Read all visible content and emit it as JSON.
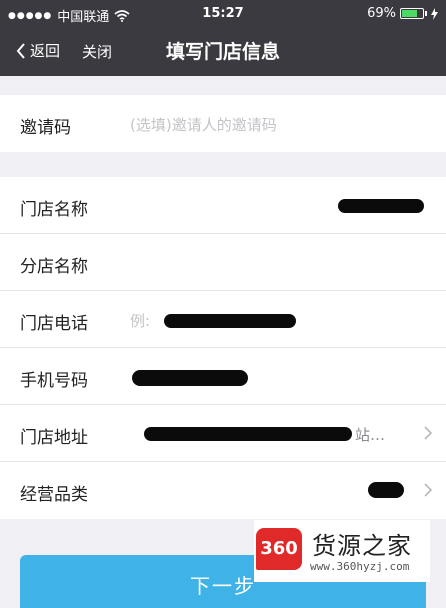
{
  "status": {
    "carrier": "中国联通",
    "time": "15:27",
    "battery": "69%",
    "battery_level": 0.69
  },
  "nav": {
    "back": "返回",
    "close": "关闭",
    "title": "填写门店信息"
  },
  "invite": {
    "label": "邀请码",
    "placeholder": "(选填)邀请人的邀请码"
  },
  "rows": [
    {
      "label": "门店名称",
      "value": ""
    },
    {
      "label": "分店名称",
      "value": ""
    },
    {
      "label": "门店电话",
      "value": "例:"
    },
    {
      "label": "手机号码",
      "value": ""
    },
    {
      "label": "门店地址",
      "value": "站…"
    },
    {
      "label": "经营品类",
      "value": ""
    }
  ],
  "next_button": "下一步",
  "watermark": {
    "logo": "360",
    "name": "货源之家",
    "url": "www.360hyzj.com"
  }
}
